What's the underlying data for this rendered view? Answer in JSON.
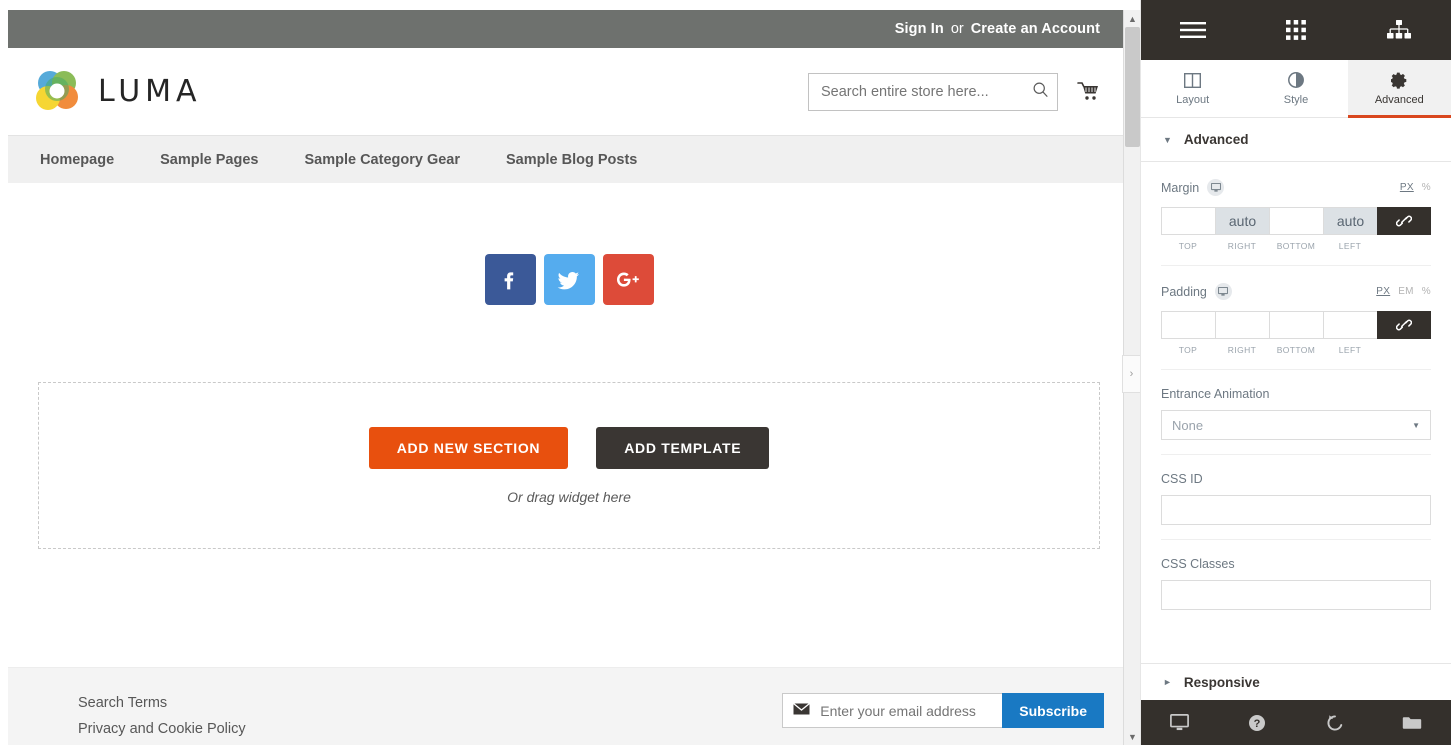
{
  "preview": {
    "topbar": {
      "sign_in": "Sign In",
      "or": "or",
      "create_account": "Create an Account"
    },
    "brand": {
      "name": "LUMA",
      "logo_colors": [
        "#4ba3dd",
        "#7cb342",
        "#f5a623",
        "#e8500e",
        "#f7d117",
        "#1d8a4d"
      ]
    },
    "search": {
      "placeholder": "Search entire store here...",
      "value": "",
      "icon": "search-icon"
    },
    "cart": {
      "icon": "shopping-cart-icon"
    },
    "nav": {
      "items": [
        {
          "label": "Homepage"
        },
        {
          "label": "Sample Pages"
        },
        {
          "label": "Sample Category Gear"
        },
        {
          "label": "Sample Blog Posts"
        }
      ]
    },
    "social": {
      "items": [
        {
          "name": "facebook",
          "glyph": "f",
          "color": "#3b5998"
        },
        {
          "name": "twitter",
          "glyph": "bird",
          "color": "#55acee"
        },
        {
          "name": "google-plus",
          "glyph": "G+",
          "color": "#dd4b39"
        }
      ]
    },
    "add_section": {
      "add_new_section": "ADD NEW SECTION",
      "add_template": "ADD TEMPLATE",
      "drag_hint": "Or drag widget here",
      "accent_color": "#e8500e",
      "dark_color": "#3a3633"
    },
    "footer": {
      "links": [
        {
          "label": "Search Terms"
        },
        {
          "label": "Privacy and Cookie Policy"
        }
      ],
      "newsletter": {
        "icon": "envelope-icon",
        "placeholder": "Enter your email address",
        "value": "",
        "subscribe_label": "Subscribe",
        "subscribe_color": "#1979c3"
      }
    },
    "collapse_handle": "›"
  },
  "panel": {
    "topbar": {
      "buttons": [
        {
          "name": "hamburger-menu-icon"
        },
        {
          "name": "widgets-grid-icon"
        },
        {
          "name": "navigator-tree-icon"
        }
      ]
    },
    "tabs": [
      {
        "label": "Layout",
        "icon": "layout-columns-icon",
        "active": false
      },
      {
        "label": "Style",
        "icon": "contrast-circle-icon",
        "active": false
      },
      {
        "label": "Advanced",
        "icon": "gear-icon",
        "active": true
      }
    ],
    "accent_color": "#d9471f",
    "section": {
      "title": "Advanced",
      "expanded": true,
      "caret": "▼"
    },
    "margin": {
      "label": "Margin",
      "responsive_icon": "desktop-icon",
      "units": [
        {
          "label": "PX",
          "active": true
        },
        {
          "label": "%",
          "active": false
        }
      ],
      "values": [
        {
          "side": "TOP",
          "value": "",
          "filled": false
        },
        {
          "side": "RIGHT",
          "value": "auto",
          "filled": true
        },
        {
          "side": "BOTTOM",
          "value": "",
          "filled": false
        },
        {
          "side": "LEFT",
          "value": "auto",
          "filled": true
        }
      ],
      "link_icon": "link-chain-icon"
    },
    "padding": {
      "label": "Padding",
      "responsive_icon": "desktop-icon",
      "units": [
        {
          "label": "PX",
          "active": true
        },
        {
          "label": "EM",
          "active": false
        },
        {
          "label": "%",
          "active": false
        }
      ],
      "values": [
        {
          "side": "TOP",
          "value": "",
          "filled": false
        },
        {
          "side": "RIGHT",
          "value": "",
          "filled": false
        },
        {
          "side": "BOTTOM",
          "value": "",
          "filled": false
        },
        {
          "side": "LEFT",
          "value": "",
          "filled": false
        }
      ],
      "link_icon": "link-chain-icon"
    },
    "entrance_animation": {
      "label": "Entrance Animation",
      "value": "None",
      "caret": "▼"
    },
    "css_id": {
      "label": "CSS ID",
      "value": "",
      "placeholder": ""
    },
    "css_classes": {
      "label": "CSS Classes",
      "value": "",
      "placeholder": ""
    },
    "responsive": {
      "title": "Responsive",
      "expanded": false,
      "caret": "►"
    },
    "footer_buttons": [
      {
        "name": "responsive-mode-icon"
      },
      {
        "name": "help-icon"
      },
      {
        "name": "history-icon"
      },
      {
        "name": "folder-library-icon"
      }
    ]
  }
}
